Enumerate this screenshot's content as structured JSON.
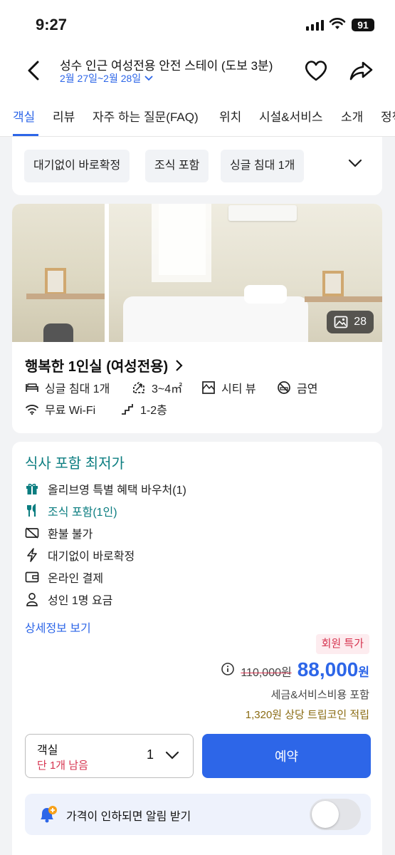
{
  "status_bar": {
    "time": "9:27",
    "battery": "91"
  },
  "header": {
    "title": "성수 인근 여성전용 안전 스테이 (도보 3분)",
    "dates": "2월 27일~2월 28일"
  },
  "tabs": [
    {
      "label": "객실",
      "active": true
    },
    {
      "label": "리뷰"
    },
    {
      "label": "자주 하는 질문(FAQ)"
    },
    {
      "label": "위치"
    },
    {
      "label": "시설&서비스"
    },
    {
      "label": "소개"
    },
    {
      "label": "정책"
    }
  ],
  "filter_chips": [
    "대기없이 바로확정",
    "조식 포함",
    "싱글 침대 1개"
  ],
  "room": {
    "photo_count": "28",
    "name": "행복한 1인실 (여성전용)",
    "amenities": {
      "bed": "싱글 침대 1개",
      "size": "3~4㎡",
      "view": "시티 뷰",
      "smoking": "금연",
      "wifi": "무료 Wi-Fi",
      "floor": "1-2층"
    }
  },
  "rate": {
    "title": "식사 포함 최저가",
    "features": {
      "voucher": "올리브영 특별 혜택 바우처(1)",
      "breakfast": "조식 포함(1인)",
      "refund": "환불 불가",
      "instant": "대기없이 바로확정",
      "payment": "온라인 결제",
      "guests": "성인 1명 요금"
    },
    "detail_link": "상세정보 보기",
    "member_badge": "회원 특가",
    "original_price": "110,000원",
    "price": "88,000",
    "price_unit": "원",
    "tax_note": "세금&서비스비용 포함",
    "coin_note": "1,320원 상당 트립코인 적립",
    "quantity": {
      "label": "객실",
      "remaining": "단 1개 남음",
      "value": "1"
    },
    "book_button": "예약",
    "price_alert": {
      "text": "가격이 인하되면 알림 받기",
      "enabled": false
    }
  },
  "colors": {
    "accent": "#2d66e8",
    "teal": "#0b7d80",
    "red": "#d6334f",
    "coin": "#8a6b12"
  }
}
